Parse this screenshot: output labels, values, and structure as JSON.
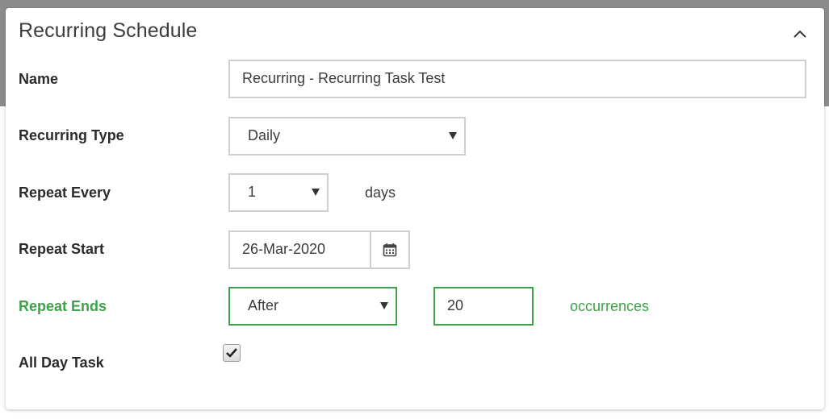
{
  "panel": {
    "title": "Recurring Schedule",
    "collapse_icon": "chevron-up-icon"
  },
  "form": {
    "name": {
      "label": "Name",
      "value": "Recurring - Recurring Task Test"
    },
    "recurring_type": {
      "label": "Recurring Type",
      "selected": "Daily"
    },
    "repeat_every": {
      "label": "Repeat Every",
      "selected": "1",
      "unit": "days"
    },
    "repeat_start": {
      "label": "Repeat Start",
      "value": "26-Mar-2020",
      "icon": "calendar-icon"
    },
    "repeat_ends": {
      "label": "Repeat Ends",
      "selected": "After",
      "count": "20",
      "unit": "occurrences"
    },
    "all_day_task": {
      "label": "All Day Task",
      "checked": true
    }
  },
  "colors": {
    "accent_green": "#3fa14a",
    "border_gray": "#cfcfcf",
    "backdrop_gray": "#8c8c8c"
  }
}
